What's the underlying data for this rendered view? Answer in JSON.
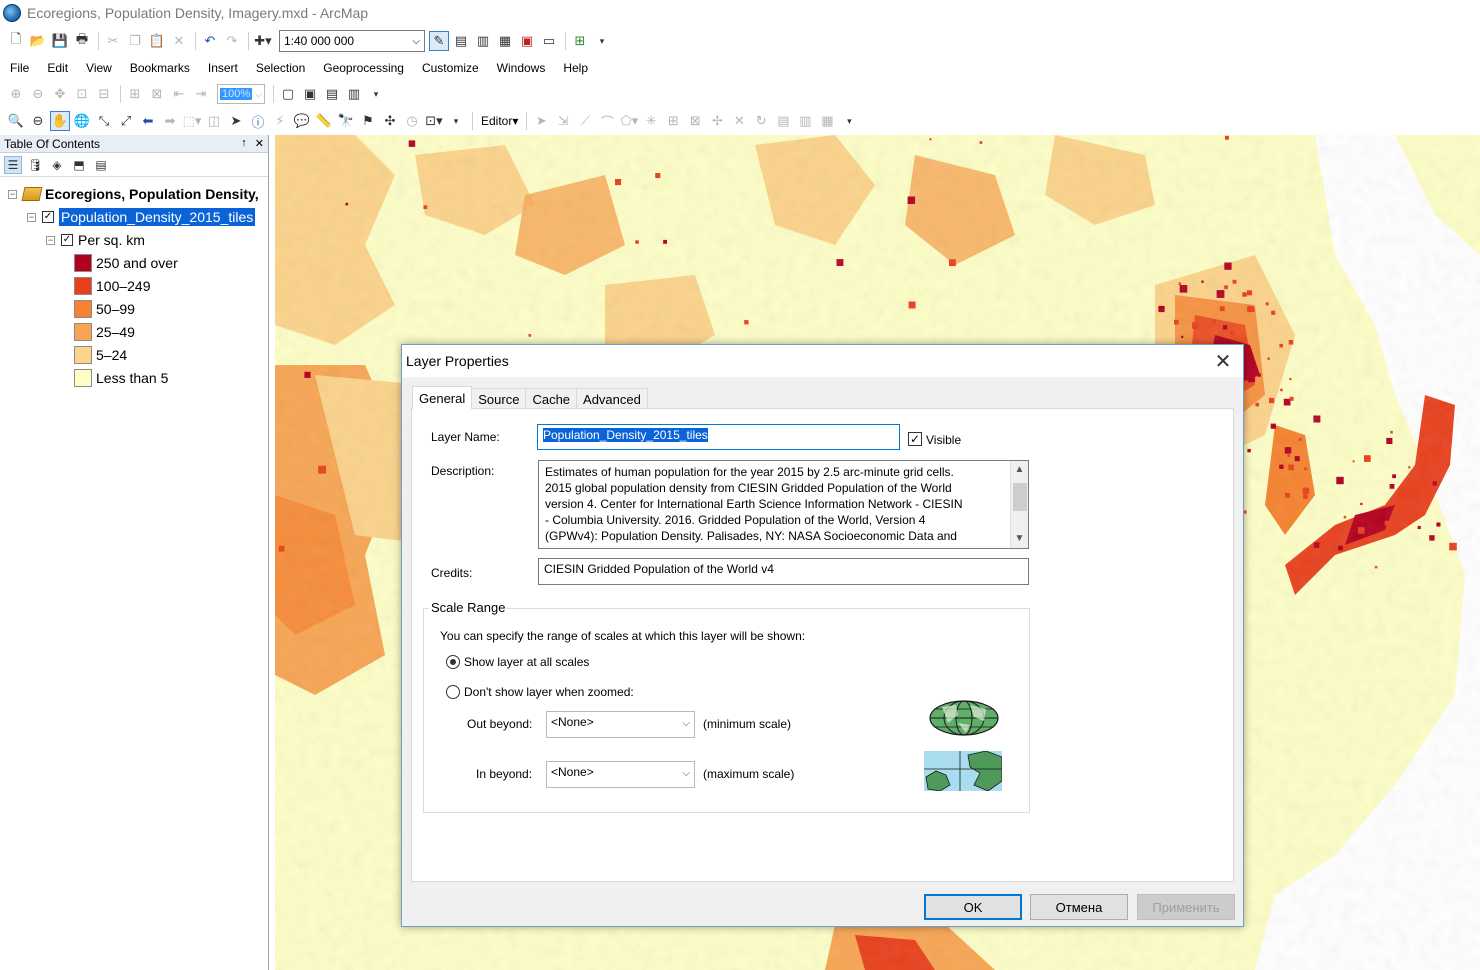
{
  "window": {
    "title": "Ecoregions, Population Density, Imagery.mxd - ArcMap"
  },
  "toolbar": {
    "scale_value": "1:40 000 000",
    "zoom_value": "100%",
    "editor_label": "Editor▾"
  },
  "menu": [
    "File",
    "Edit",
    "View",
    "Bookmarks",
    "Insert",
    "Selection",
    "Geoprocessing",
    "Customize",
    "Windows",
    "Help"
  ],
  "toc": {
    "title": "Table Of Contents",
    "pin": "↑",
    "close": "✕",
    "data_frame": "Ecoregions, Population Density,",
    "layer": "Population_Density_2015_tiles",
    "field": "Per sq. km",
    "legend": [
      {
        "label": "250 and over",
        "color": "#b3001e"
      },
      {
        "label": "100–249",
        "color": "#e8401c"
      },
      {
        "label": "50–99",
        "color": "#f5822f"
      },
      {
        "label": "25–49",
        "color": "#f7a553"
      },
      {
        "label": "5–24",
        "color": "#fbd38a"
      },
      {
        "label": "Less than 5",
        "color": "#fdfdc6"
      }
    ]
  },
  "dialog": {
    "title": "Layer Properties",
    "close": "✕",
    "tabs": [
      "General",
      "Source",
      "Cache",
      "Advanced"
    ],
    "layer_name_label": "Layer Name:",
    "layer_name_value": "Population_Density_2015_tiles",
    "visible_label": "Visible",
    "visible_checked": true,
    "description_label": "Description:",
    "description_lines": [
      "Estimates of human population for the year 2015 by 2.5 arc-minute grid cells.",
      "2015 global population density from CIESIN Gridded Population of the World",
      "version 4. Center for International Earth Science Information Network - CIESIN",
      "- Columbia University. 2016. Gridded Population of the World, Version 4",
      "(GPWv4): Population Density. Palisades, NY: NASA Socioeconomic Data and"
    ],
    "credits_label": "Credits:",
    "credits_value": "CIESIN Gridded Population of the World v4",
    "scale_range": {
      "title": "Scale Range",
      "intro": "You can specify the range of scales at which this layer will be shown:",
      "option_all": "Show layer at all scales",
      "option_zoomed": "Don't show layer when zoomed:",
      "out_beyond_label": "Out beyond:",
      "out_beyond_value": "<None>",
      "min_scale_label": "(minimum scale)",
      "in_beyond_label": "In beyond:",
      "in_beyond_value": "<None>",
      "max_scale_label": "(maximum scale)"
    },
    "buttons": {
      "ok": "OK",
      "cancel": "Отмена",
      "apply": "Применить"
    }
  }
}
